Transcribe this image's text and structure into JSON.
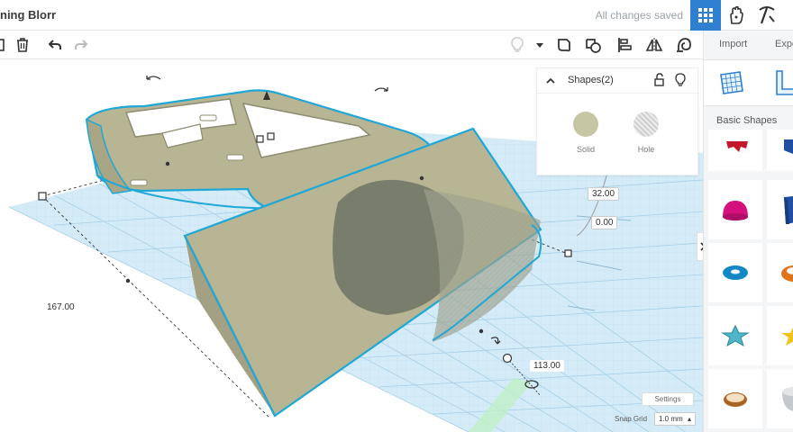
{
  "header": {
    "title": "ning Blorr",
    "status": "All changes saved"
  },
  "toolbar": {
    "icons": [
      "trash-icon",
      "undo-icon",
      "redo-icon",
      "light-bulb-icon",
      "dropdown-icon",
      "note-icon",
      "group-icon",
      "align-icon",
      "mirror-icon",
      "cruise-icon"
    ]
  },
  "canvas": {
    "dimension_depth": "167.00",
    "dimension_width": "113.00",
    "dimension_height": "32.00",
    "dimension_elevation": "0.00"
  },
  "inspector": {
    "title": "Shapes(2)",
    "solid_label": "Solid",
    "hole_label": "Hole",
    "solid_color": "#c7c6a4"
  },
  "right_panel": {
    "import_label": "Import",
    "export_label": "Expo",
    "category_label": "Basic Shapes"
  },
  "footer": {
    "settings_label": "Settings",
    "snap_label": "Snap Grid",
    "snap_value": "1.0 mm"
  },
  "colors": {
    "accent": "#2f80d1",
    "selection": "#1fa7d6",
    "workplane": "#cfe7f6",
    "shape": "#b8b594"
  }
}
